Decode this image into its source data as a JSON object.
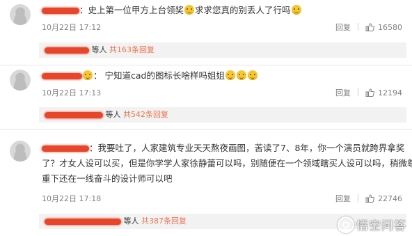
{
  "comments": [
    {
      "text": "：史上第一位甲方上台领奖",
      "text_after_emoji": "求求您真的别丢人了行吗",
      "time": "10月22日 17:12",
      "reply_label": "回复",
      "likes": "16580",
      "reply_suffix": "等人",
      "reply_count_text": "共163条回复"
    },
    {
      "text": "宁知道cad的图标长啥样吗姐姐",
      "time": "10月22日 17:13",
      "reply_label": "回复",
      "likes": "12194",
      "reply_suffix": "等人",
      "reply_count_text": "共542条回复"
    },
    {
      "line1": "我要吐了，人家建筑专业天天熬夜画图，苦读了7、8年，你一个演员就跨界拿奖",
      "line2": "了？才女人设可以买，但是你学学人家徐静蕾可以吗，别随便在一个领域瞎买人设可以吗，稍微尊",
      "line3": "重下还在一线奋斗的设计师可以吧",
      "time": "10月22日 17:18",
      "reply_label": "回复",
      "likes": "22746",
      "reply_suffix": "等人",
      "reply_count_text": "共387条回复"
    }
  ],
  "watermark": "悟空问答",
  "icons": {
    "like": "thumbs-up-icon",
    "avatar": "avatar-icon",
    "emoji": "emoji-icon",
    "logo": "wukong-logo-icon"
  },
  "colors": {
    "reply_count": "#eb7350",
    "redaction": "#e8462a",
    "reply_bg": "#f2f2f2"
  }
}
